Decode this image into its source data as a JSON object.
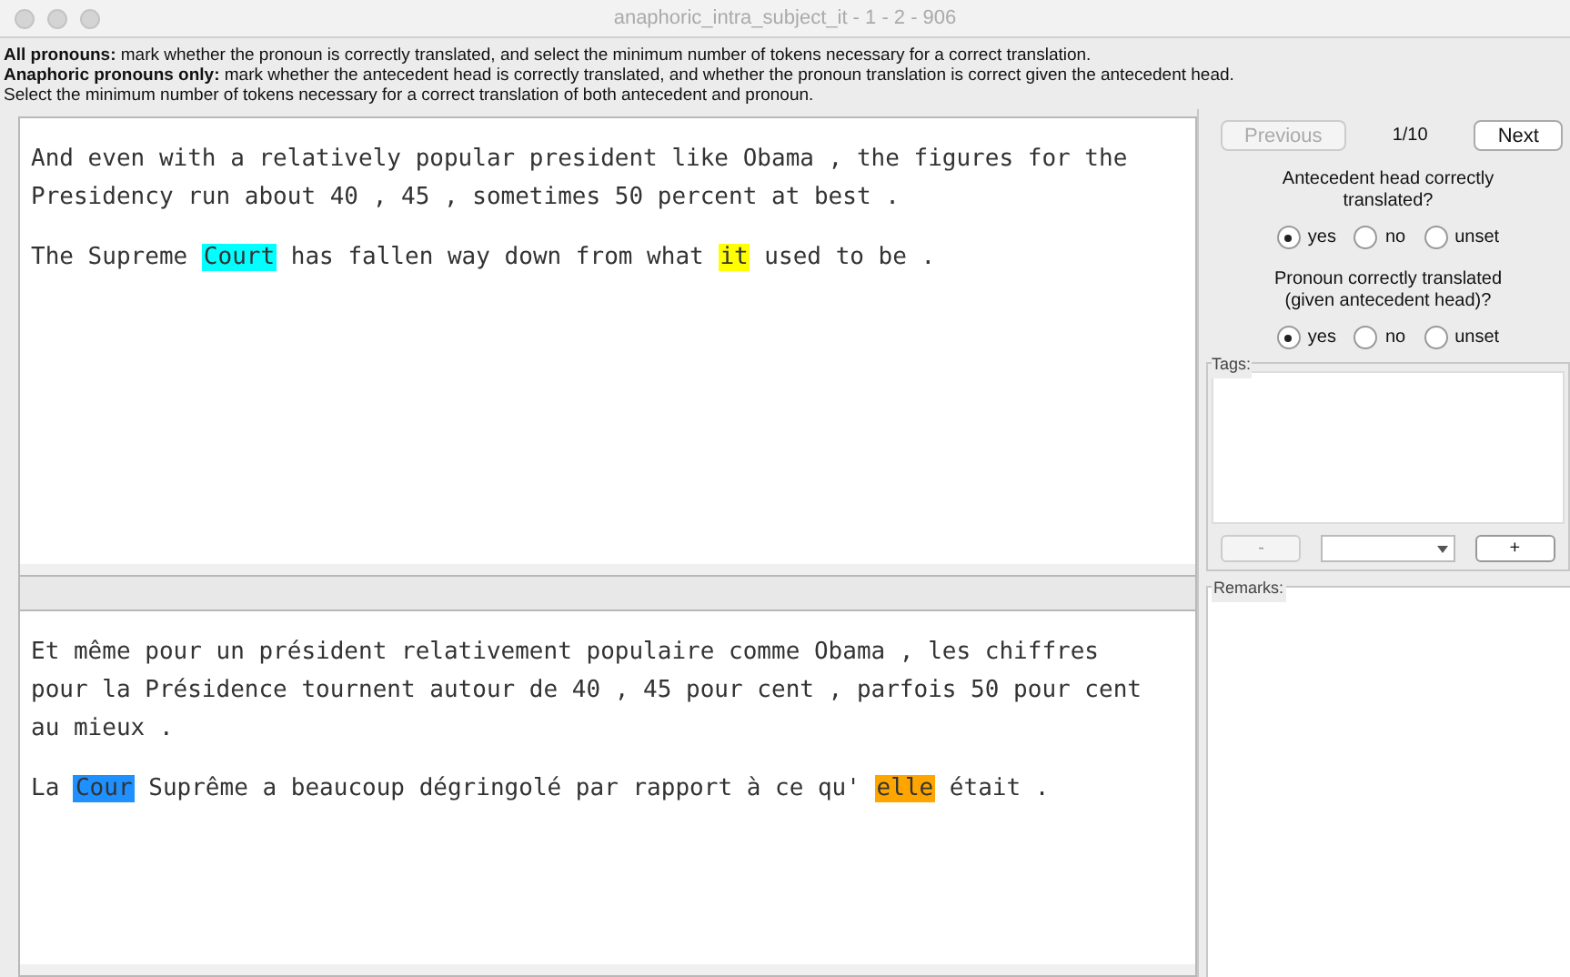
{
  "window": {
    "title": "anaphoric_intra_subject_it - 1 - 2 - 906"
  },
  "instructions": [
    "**All pronouns:** mark whether the pronoun is correctly translated, and select the minimum number of tokens necessary for a correct translation.",
    "**Anaphoric pronouns only:** mark whether the antecedent head is correctly translated, and whether the pronoun translation is correct given the antecedent head.",
    "Select the minimum number of tokens necessary for a correct translation of both antecedent and pronoun."
  ],
  "source": [
    [
      {
        "text": "And even with a relatively popular president like Obama , the figures for the Presidency run about 40 , 45 , sometimes 50 percent at best ."
      }
    ],
    [
      {
        "text": "The Supreme "
      },
      {
        "text": "Court",
        "color": "#00ffff"
      },
      {
        "text": " has fallen way down from what "
      },
      {
        "text": "it",
        "color": "#ffff00"
      },
      {
        "text": " used to be ."
      }
    ]
  ],
  "target": [
    [
      {
        "text": "Et même pour un président relativement populaire comme Obama , les chiffres pour la Présidence tournent autour de 40 , 45 pour cent , parfois 50 pour cent au mieux ."
      }
    ],
    [
      {
        "text": "La "
      },
      {
        "text": "Cour",
        "color": "#1e90ff"
      },
      {
        "text": " Suprême a beaucoup dégringolé par rapport à ce qu' "
      },
      {
        "text": "elle",
        "color": "#ffa500"
      },
      {
        "text": " était ."
      }
    ]
  ],
  "navigation": {
    "previous": {
      "label": "Previous",
      "disabled": true
    },
    "counter": "1/10",
    "next": {
      "label": "Next",
      "disabled": false
    }
  },
  "questions": [
    {
      "label": "Antecedent head correctly translated?",
      "options": [
        {
          "label": "yes",
          "selected": true
        },
        {
          "label": "no",
          "selected": false
        },
        {
          "label": "unset",
          "selected": false
        }
      ]
    },
    {
      "label": "Pronoun correctly translated (given antecedent head)?",
      "options": [
        {
          "label": "yes",
          "selected": true
        },
        {
          "label": "no",
          "selected": false
        },
        {
          "label": "unset",
          "selected": false
        }
      ]
    }
  ],
  "tags": {
    "label": "Tags:",
    "remove": "-",
    "add": "+"
  },
  "remarks": {
    "label": "Remarks:"
  }
}
